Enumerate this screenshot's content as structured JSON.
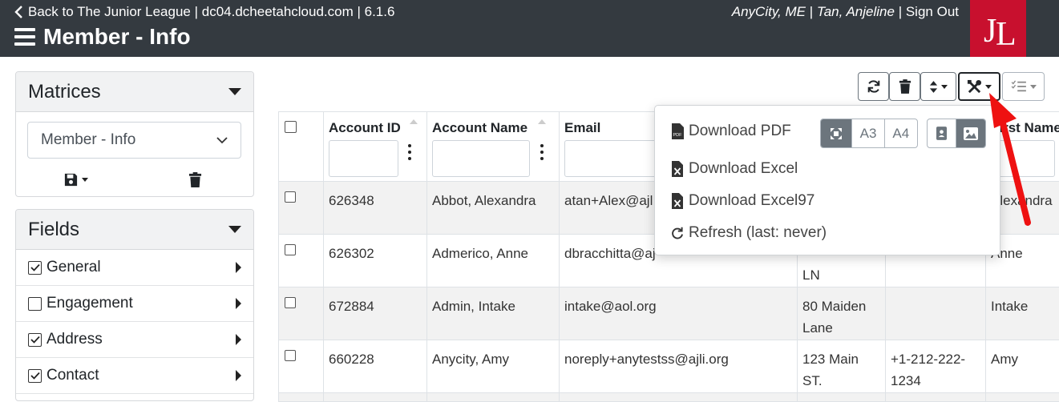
{
  "header": {
    "back_link": "Back to The Junior League | dc04.dcheetahcloud.com | 6.1.6",
    "page_title": "Member - Info",
    "location": "AnyCity, ME",
    "user": "Tan, Anjeline",
    "sign_out": "Sign Out",
    "separator": "|",
    "logo_text": "JL",
    "colors": {
      "bar": "#343a40",
      "logo_bg": "#c8102e"
    }
  },
  "sidebar": {
    "matrices": {
      "title": "Matrices",
      "selected": "Member - Info"
    },
    "fields": {
      "title": "Fields",
      "items": [
        {
          "label": "General",
          "checked": true
        },
        {
          "label": "Engagement",
          "checked": false
        },
        {
          "label": "Address",
          "checked": true
        },
        {
          "label": "Contact",
          "checked": true
        }
      ]
    }
  },
  "toolbar": {
    "icons": [
      "refresh-icon",
      "trash-icon",
      "sort-icon",
      "tools-icon",
      "column-list-icon"
    ]
  },
  "table": {
    "columns": [
      "Account ID",
      "Account Name",
      "Email",
      "",
      "",
      "First Name"
    ],
    "rows": [
      {
        "id": "626348",
        "name": "Abbot, Alexandra",
        "email": "atan+Alex@ajl",
        "address": "",
        "phone": "",
        "first": "Alexandra"
      },
      {
        "id": "626302",
        "name": "Admerico, Anne",
        "email": "dbracchitta@aj",
        "address": "LN",
        "phone": "",
        "first": "Anne"
      },
      {
        "id": "672884",
        "name": "Admin, Intake",
        "email": "intake@aol.org",
        "address": "80 Maiden Lane",
        "phone": "",
        "first": "Intake"
      },
      {
        "id": "660228",
        "name": "Anycity, Amy",
        "email": "noreply+anytestss@ajli.org",
        "address": "123 Main ST.",
        "phone": "+1-212-222-1234",
        "first": "Amy"
      }
    ]
  },
  "dropdown": {
    "download_pdf": "Download PDF",
    "sizes": [
      "A3",
      "A4"
    ],
    "download_excel": "Download Excel",
    "download_excel97": "Download Excel97",
    "refresh": "Refresh (last: never)"
  }
}
